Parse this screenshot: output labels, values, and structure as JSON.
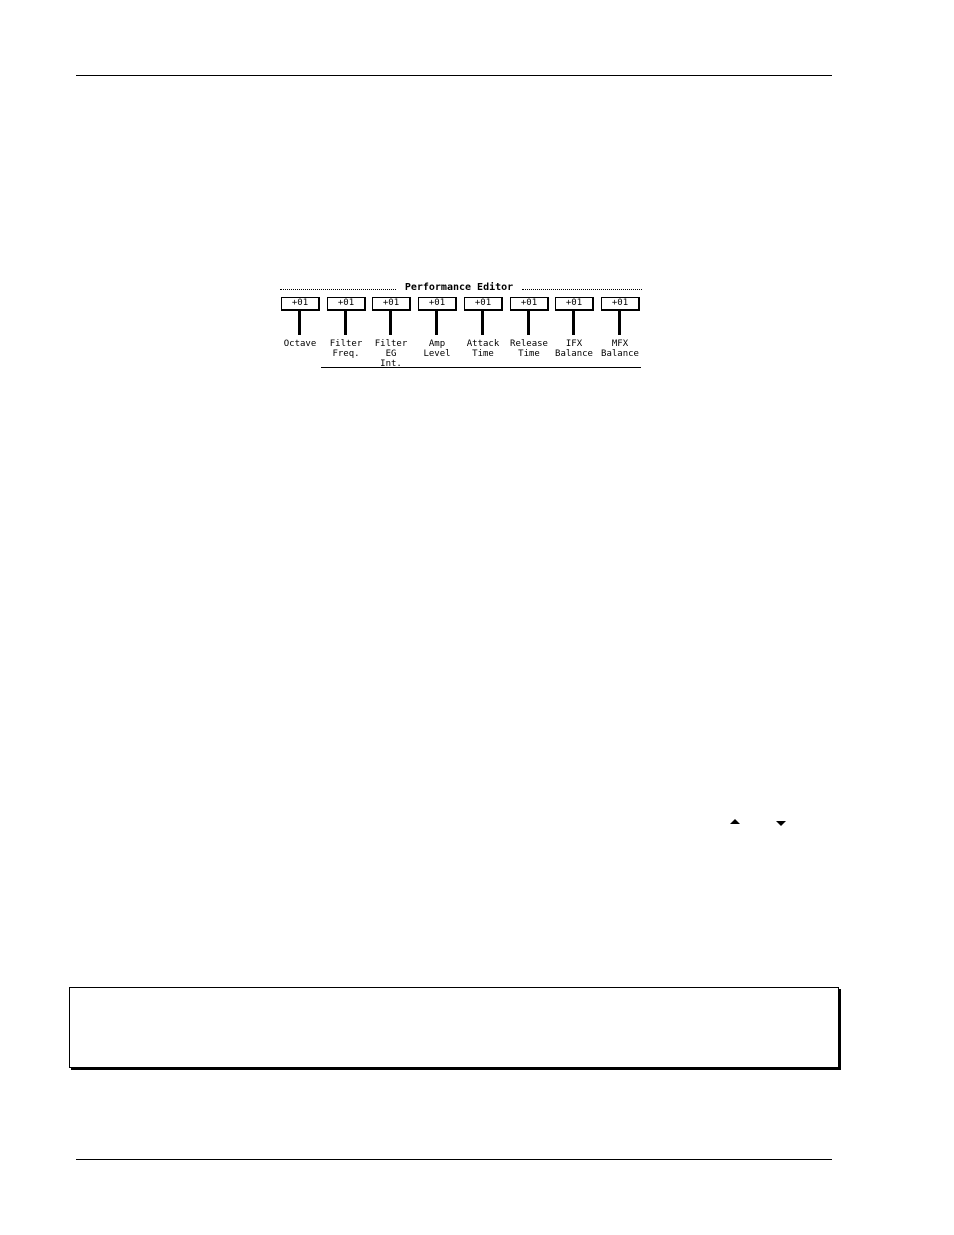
{
  "figure": {
    "title": "Performance Editor",
    "sliders": [
      {
        "value": "+01",
        "label_line1": "Octave",
        "label_line2": ""
      },
      {
        "value": "+01",
        "label_line1": "Filter",
        "label_line2": "Freq."
      },
      {
        "value": "+01",
        "label_line1": "Filter EG",
        "label_line2": "Int."
      },
      {
        "value": "+01",
        "label_line1": "Amp",
        "label_line2": "Level"
      },
      {
        "value": "+01",
        "label_line1": "Attack",
        "label_line2": "Time"
      },
      {
        "value": "+01",
        "label_line1": "Release",
        "label_line2": "Time"
      },
      {
        "value": "+01",
        "label_line1": "IFX",
        "label_line2": "Balance"
      },
      {
        "value": "+01",
        "label_line1": "MFX",
        "label_line2": "Balance"
      }
    ]
  },
  "icons": {
    "up": "arrow-up",
    "down": "arrow-down"
  }
}
